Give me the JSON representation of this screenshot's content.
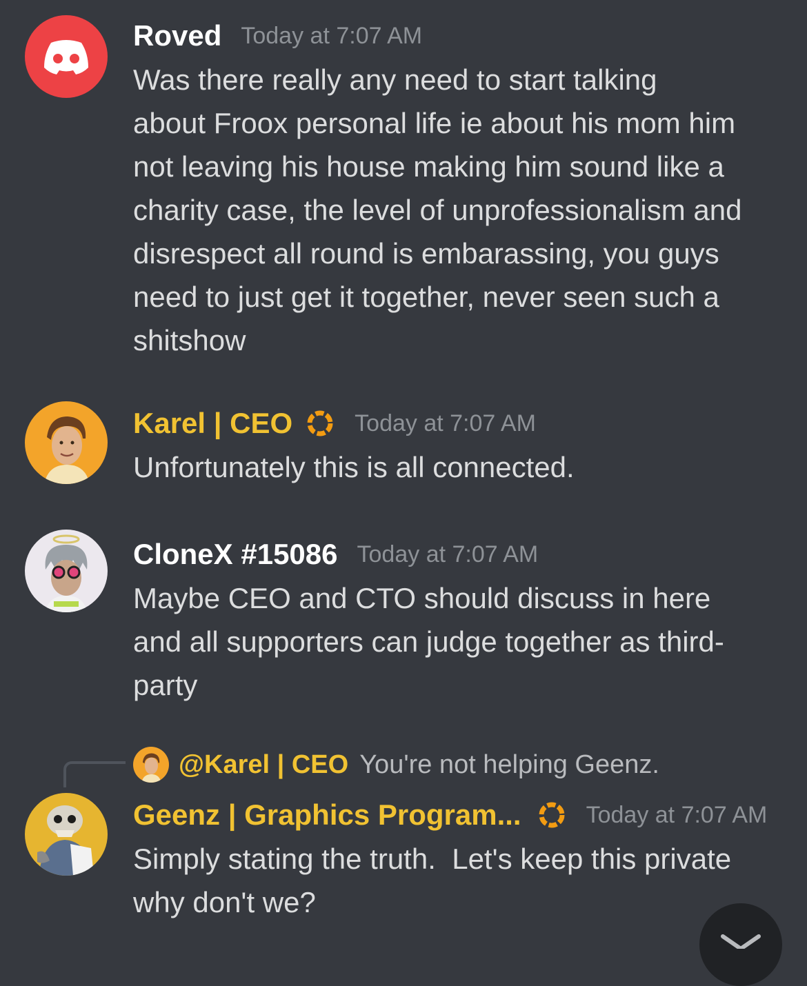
{
  "messages": [
    {
      "author": "Roved",
      "timestamp": "Today at 7:07 AM",
      "lines": [
        "Was there really any need to start talking",
        "about Froox personal life ie about his mom him",
        "not leaving his house making him sound like a",
        "charity case, the level of unprofessionalism and",
        "disrespect all round is embarassing, you guys",
        "need to just get it together, never seen such a",
        "shitshow"
      ],
      "avatar": "discord-logo-icon"
    },
    {
      "author": "Karel | CEO",
      "timestamp": "Today at 7:07 AM",
      "lines": [
        "Unfortunately this is all connected."
      ],
      "avatar": "karel-avatar",
      "role_icon": "orange-ring-icon"
    },
    {
      "author": "CloneX #15086",
      "timestamp": "Today at 7:07 AM",
      "lines": [
        "Maybe CEO and CTO should discuss in here",
        "and all supporters can judge together as third-",
        "party"
      ],
      "avatar": "clonex-avatar"
    },
    {
      "reply_to": {
        "author": "@Karel | CEO",
        "text": "You're not helping Geenz."
      },
      "author": "Geenz | Graphics Program...",
      "timestamp": "Today at 7:07 AM",
      "lines": [
        "Simply stating the truth.  Let's keep this private",
        "why don't we?"
      ],
      "avatar": "geenz-avatar",
      "role_icon": "orange-ring-icon"
    }
  ],
  "colors": {
    "background": "#36393f",
    "role_gold": "#f1c232",
    "timestamp": "#8e9297",
    "text": "#dcddde",
    "discord_red": "#ed4245",
    "role_ring": "#f39c12"
  },
  "jump_button": {
    "icon": "chevron-down-icon"
  }
}
